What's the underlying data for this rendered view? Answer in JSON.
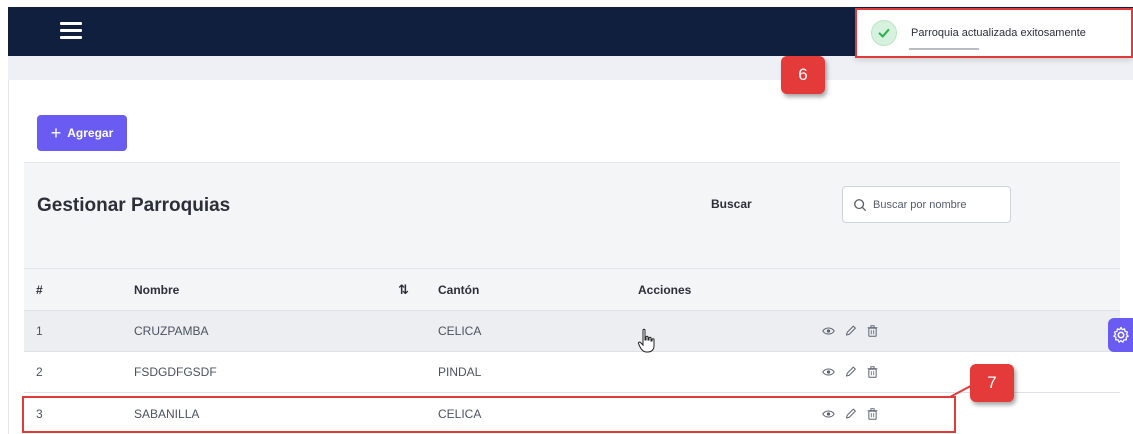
{
  "header": {
    "menu_icon": "hamburger-icon"
  },
  "toast": {
    "message": "Parroquia actualizada exitosamente",
    "icon": "check-circle-icon",
    "accent": "#2eb24f"
  },
  "toolbar": {
    "add_label": "Agregar"
  },
  "page": {
    "title": "Gestionar Parroquias"
  },
  "search": {
    "label": "Buscar",
    "placeholder": "Buscar por nombre"
  },
  "table": {
    "headers": {
      "num": "#",
      "name": "Nombre",
      "sort_icon": "⇅",
      "canton": "Cantón",
      "actions": "Acciones"
    },
    "rows": [
      {
        "num": "1",
        "name": "CRUZPAMBA",
        "canton": "CELICA"
      },
      {
        "num": "2",
        "name": "FSDGDFGSDF",
        "canton": "PINDAL"
      },
      {
        "num": "3",
        "name": "SABANILLA",
        "canton": "CELICA"
      }
    ],
    "action_icons": [
      "eye-icon",
      "pencil-icon",
      "trash-icon"
    ]
  },
  "annotations": {
    "badge_toast": "6",
    "badge_row": "7",
    "color": "#e53a3a"
  },
  "colors": {
    "brand": "#6a5cf3",
    "navbar": "#0f1f3d"
  }
}
